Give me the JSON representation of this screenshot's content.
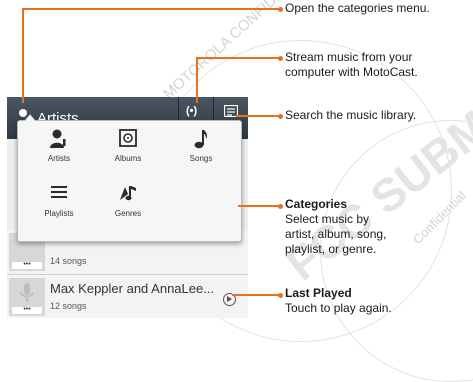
{
  "watermark": {
    "line1": "MOTOROLA CONFIDENTIAL RESTRICTED",
    "line2": "FCC SUBMISSION",
    "line3": "Confidential"
  },
  "action_bar": {
    "title": "Artists",
    "cast_icon": "(•)"
  },
  "categories_popup": {
    "items": [
      {
        "label": "Artists",
        "icon": "person-icon"
      },
      {
        "label": "Albums",
        "icon": "album-icon"
      },
      {
        "label": "Songs",
        "icon": "music-note-icon"
      },
      {
        "label": "Playlists",
        "icon": "playlist-icon"
      },
      {
        "label": "Genres",
        "icon": "genres-icon"
      }
    ]
  },
  "list": {
    "rows": [
      {
        "title": "",
        "subtitle": "14 songs"
      },
      {
        "title": "Max Keppler and AnnaLee...",
        "subtitle": "12 songs"
      }
    ],
    "thumb_dots": "•••"
  },
  "callouts": {
    "open_categories": "Open the categories menu.",
    "stream": "Stream music from your computer with MotoCast.",
    "stream_line1": "Stream music from your",
    "stream_line2": "computer with MotoCast.",
    "search": "Search the music library.",
    "categories_title": "Categories",
    "categories_line1": "Select music by",
    "categories_line2": "artist, album, song,",
    "categories_line3": "playlist, or genre.",
    "last_played_title": "Last Played",
    "last_played_line1": "Touch to play again."
  },
  "colors": {
    "accent": "#e8701e",
    "action_bar": "#3a4550"
  }
}
